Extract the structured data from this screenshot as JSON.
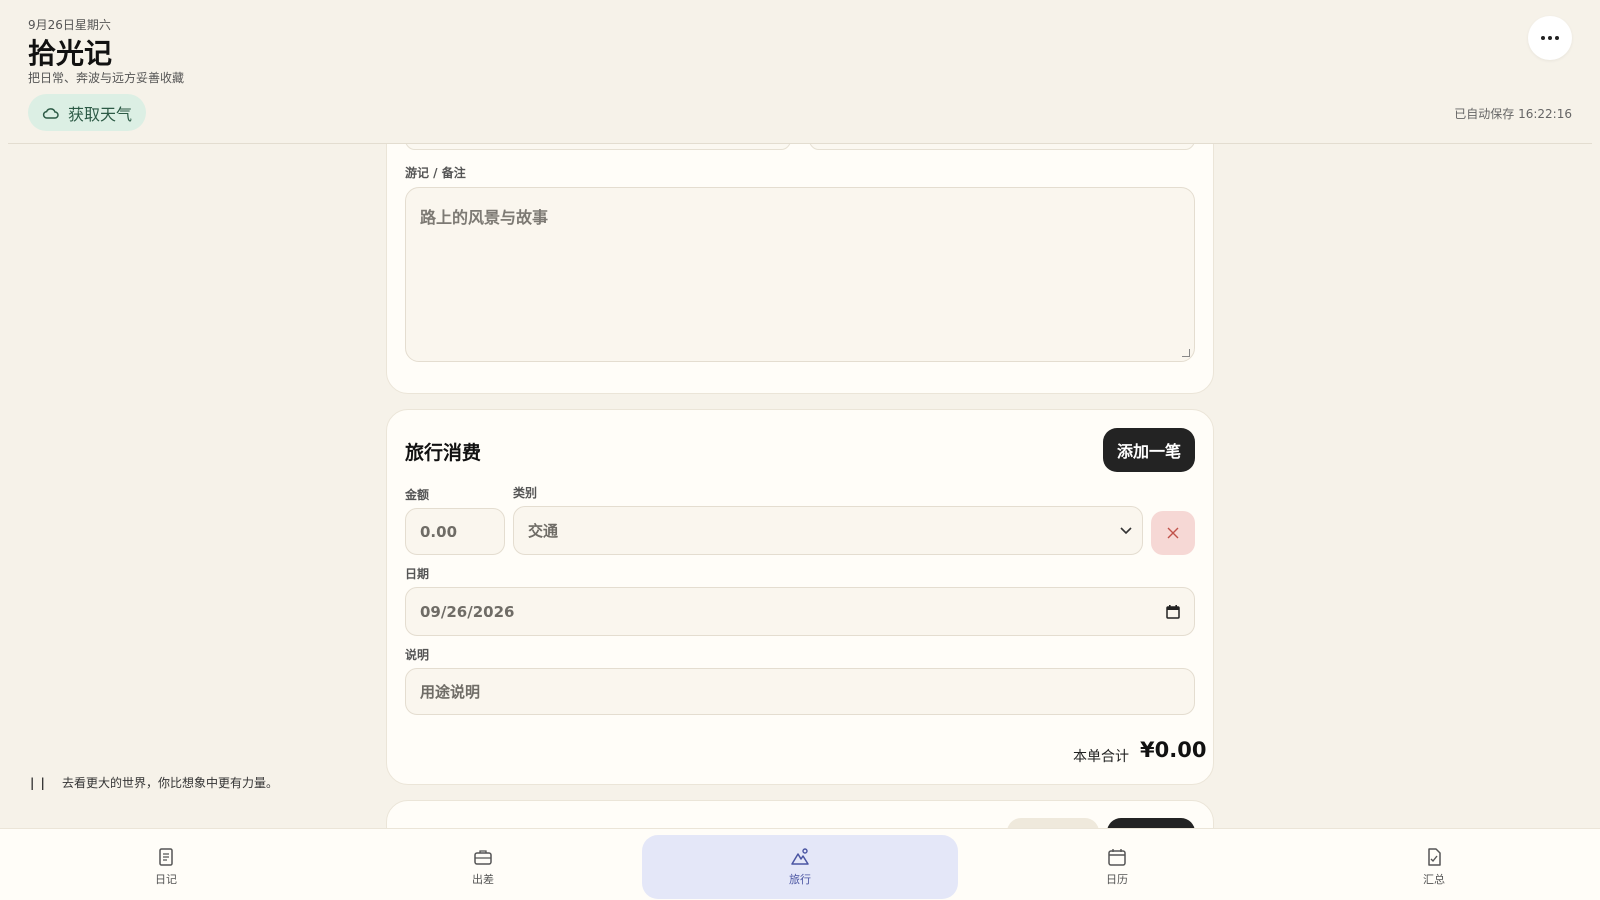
{
  "header": {
    "date": "9月26日星期六",
    "title": "拾光记",
    "subtitle": "把日常、奔波与远方妥善收藏",
    "weather_button": "获取天气",
    "autosave": "已自动保存 16:22:16"
  },
  "journal": {
    "label": "游记 / 备注",
    "placeholder": "路上的风景与故事"
  },
  "expenses": {
    "title": "旅行消费",
    "add_button": "添加一笔",
    "amount_label": "金额",
    "amount_placeholder": "0.00",
    "category_label": "类别",
    "category_value": "交通",
    "date_label": "日期",
    "date_value": "09/26/2026",
    "note_label": "说明",
    "note_placeholder": "用途说明",
    "total_label": "本单合计",
    "total_value": "¥0.00"
  },
  "quote": {
    "text": "去看更大的世界，你比想象中更有力量。"
  },
  "nav": {
    "items": [
      {
        "label": "日记",
        "icon": "note-icon"
      },
      {
        "label": "出差",
        "icon": "briefcase-icon"
      },
      {
        "label": "旅行",
        "icon": "mountain-icon",
        "active": true
      },
      {
        "label": "日历",
        "icon": "calendar-icon"
      },
      {
        "label": "汇总",
        "icon": "report-icon"
      }
    ]
  },
  "colors": {
    "background": "#f6f2e9",
    "accent_nav": "#4a55a2",
    "primary_button": "#232323",
    "weather_chip": "#dcefe4",
    "delete_button": "#f6d8d5"
  }
}
